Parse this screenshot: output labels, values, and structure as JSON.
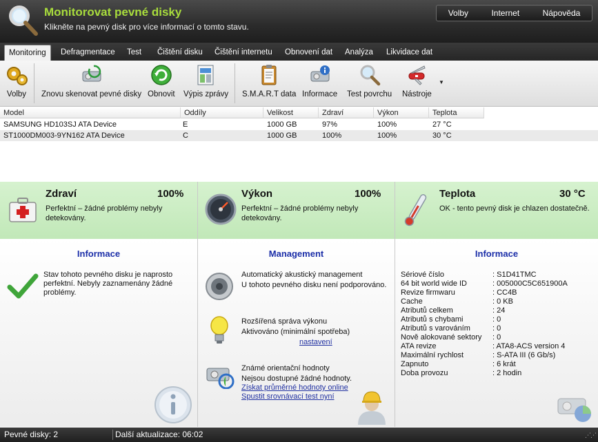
{
  "header": {
    "title": "Monitorovat pevné disky",
    "subtitle": "Klikněte na pevný disk pro více informací o tomto stavu.",
    "nav": [
      "Volby",
      "Internet",
      "Nápověda"
    ]
  },
  "tabs": [
    "Monitoring",
    "Defragmentace",
    "Test",
    "Čištění disku",
    "Čištění internetu",
    "Obnovení dat",
    "Analýza",
    "Likvidace dat"
  ],
  "toolbar": {
    "options": "Volby",
    "rescan": "Znovu skenovat pevné disky",
    "refresh": "Obnovit",
    "report": "Výpis zprávy",
    "smart": "S.M.A.R.T data",
    "info": "Informace",
    "surface": "Test povrchu",
    "tools": "Nástroje"
  },
  "table": {
    "headers": [
      "Model",
      "Oddíly",
      "Velikost",
      "Zdraví",
      "Výkon",
      "Teplota"
    ],
    "rows": [
      [
        "SAMSUNG HD103SJ ATA Device",
        "E",
        "1000 GB",
        "97%",
        "100%",
        "27 °C"
      ],
      [
        "ST1000DM003-9YN162 ATA Device",
        "C",
        "1000 GB",
        "100%",
        "100%",
        "30 °C"
      ]
    ]
  },
  "health": {
    "title": "Zdraví",
    "value": "100%",
    "desc": "Perfektní – žádné problémy nebyly detekovány.",
    "heading": "Informace",
    "text": "Stav tohoto pevného disku je naprosto perfektní. Nebyly zaznamenány žádné problémy."
  },
  "performance": {
    "title": "Výkon",
    "value": "100%",
    "desc": "Perfektní – žádné problémy nebyly detekovány.",
    "heading": "Management",
    "aam_title": "Automatický akustický management",
    "aam_text": "U tohoto pevného disku není podporováno.",
    "apm_title": "Rozšířená správa výkonu",
    "apm_text": "Aktivováno (minimální spotřeba)",
    "apm_link": "nastavení",
    "bench_title": "Známé orientační hodnoty",
    "bench_text": "Nejsou dostupné žádné hodnoty.",
    "bench_link1": "Získat průměrné hodnoty online",
    "bench_link2": "Spustit srovnávací test nyní"
  },
  "temperature": {
    "title": "Teplota",
    "value": "30 °C",
    "desc": "OK - tento pevný disk je chlazen dostatečně.",
    "heading": "Informace",
    "info": [
      [
        "Sériové číslo",
        ": S1D41TMC"
      ],
      [
        "64 bit world wide ID",
        ": 005000C5C651900A"
      ],
      [
        "Revize firmwaru",
        ": CC4B"
      ],
      [
        "Cache",
        ": 0 KB"
      ],
      [
        "Atributů celkem",
        ": 24"
      ],
      [
        "Atributů s chybami",
        ": 0"
      ],
      [
        "Atributů s varováním",
        ": 0"
      ],
      [
        "Nově alokované sektory",
        ": 0"
      ],
      [
        "ATA revize",
        ": ATA8-ACS version 4"
      ],
      [
        "Maximální rychlost",
        ": S-ATA III (6 Gb/s)"
      ],
      [
        "Zapnuto",
        ": 6 krát"
      ],
      [
        "Doba provozu",
        ": 2 hodin"
      ]
    ]
  },
  "status": {
    "disks": "Pevné disky: 2",
    "next_update": "Další aktualizace: 06:02"
  },
  "colors": {
    "accent_green": "#a8dc3c",
    "panel_green": "#c8ecbf",
    "heading_blue": "#1b2ea8",
    "link_blue": "#1f2fa0"
  }
}
